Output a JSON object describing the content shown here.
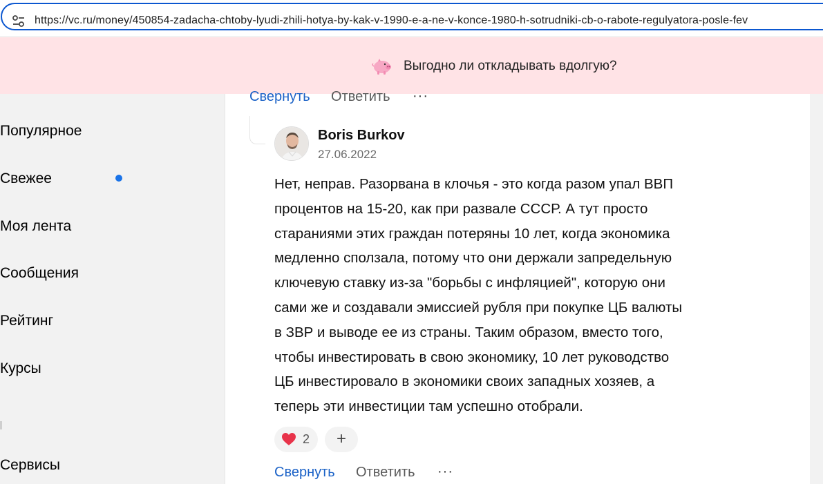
{
  "browser": {
    "url": "https://vc.ru/money/450854-zadacha-chtoby-lyudi-zhili-hotya-by-kak-v-1990-e-a-ne-v-konce-1980-h-sotrudniki-cb-o-rabote-regulyatora-posle-fev",
    "site_info_icon": "tune-icon"
  },
  "banner": {
    "icon": "piggy-bank-icon",
    "text": "Выгодно ли откладывать вдолгую?"
  },
  "sidebar": {
    "items": [
      {
        "label": "Популярное"
      },
      {
        "label": "Свежее",
        "has_dot": true
      },
      {
        "label": "Моя лента"
      },
      {
        "label": "Сообщения"
      },
      {
        "label": "Рейтинг"
      },
      {
        "label": "Курсы"
      },
      {
        "label": "Сервисы"
      }
    ],
    "dot_color": "#1a73e8"
  },
  "parent_actions": {
    "collapse_label": "Свернуть",
    "reply_label": "Ответить",
    "more_label": "···"
  },
  "comment": {
    "author": "Boris Burkov",
    "date": "27.06.2022",
    "lines": [
      "Нет, неправ. Разорвана в клочья - это когда разом упал ВВП",
      "процентов на 15-20, как при развале СССР. А тут просто",
      "стараниями этих граждан потеряны 10 лет, когда экономика",
      "медленно сползала, потому что они держали запредельную",
      "ключевую ставку из-за \"борьбы с инфляцией\", которую они",
      "сами же и создавали эмиссией рубля при покупке ЦБ валюты",
      "в ЗВР и выводе ее из страны. Таким образом, вместо того,",
      "чтобы инвестировать в свою экономику, 10 лет руководство",
      "ЦБ инвестировало в экономики своих западных хозяев, а",
      "теперь эти инвестиции там успешно отобрали."
    ],
    "reaction": {
      "icon": "heart-icon",
      "count": "2"
    },
    "add_reaction_label": "+",
    "collapse_label": "Свернуть",
    "reply_label": "Ответить",
    "more_label": "···"
  },
  "colors": {
    "link_blue": "#1b62c7",
    "banner_bg": "#ffe3e6",
    "address_border": "#0b57d0"
  }
}
